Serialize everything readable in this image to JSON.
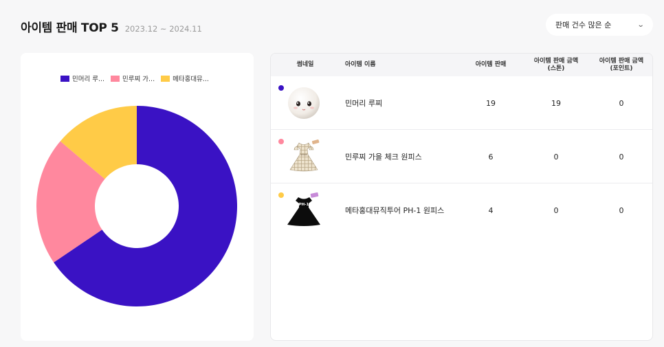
{
  "header": {
    "title": "아이템 판매 TOP 5",
    "period": "2023.12 ~ 2024.11"
  },
  "sort": {
    "label": "판매 건수 많은 순",
    "icon": "chevron-down-icon"
  },
  "chart_data": {
    "type": "pie",
    "donut": true,
    "categories": [
      "민머리 루...",
      "민루찌 가...",
      "메타홍대뮤..."
    ],
    "values": [
      19,
      6,
      4
    ],
    "colors": [
      "#3a12c4",
      "#ff889e",
      "#ffcb47"
    ],
    "legend": "top"
  },
  "table": {
    "headers": {
      "thumbnail": "썸네일",
      "name": "아이템 이름",
      "sales": "아이템 판매",
      "amount_stone": "아이템 판매 금액\n(스톤)",
      "amount_point": "아이템 판매 금액\n(포인트)"
    },
    "rows": [
      {
        "color": "#3a12c4",
        "thumb": "doll-head-icon",
        "name": "민머리 루찌",
        "sales": "19",
        "stone": "19",
        "point": "0"
      },
      {
        "color": "#ff889e",
        "thumb": "plaid-dress-icon",
        "name": "민루찌 가을 체크 원피스",
        "sales": "6",
        "stone": "0",
        "point": "0"
      },
      {
        "color": "#ffcb47",
        "thumb": "black-dress-icon",
        "name": "메타홍대뮤직투어 PH-1 원피스",
        "sales": "4",
        "stone": "0",
        "point": "0"
      }
    ]
  },
  "thumb_texts": {
    "dress_label": "PH-1"
  }
}
